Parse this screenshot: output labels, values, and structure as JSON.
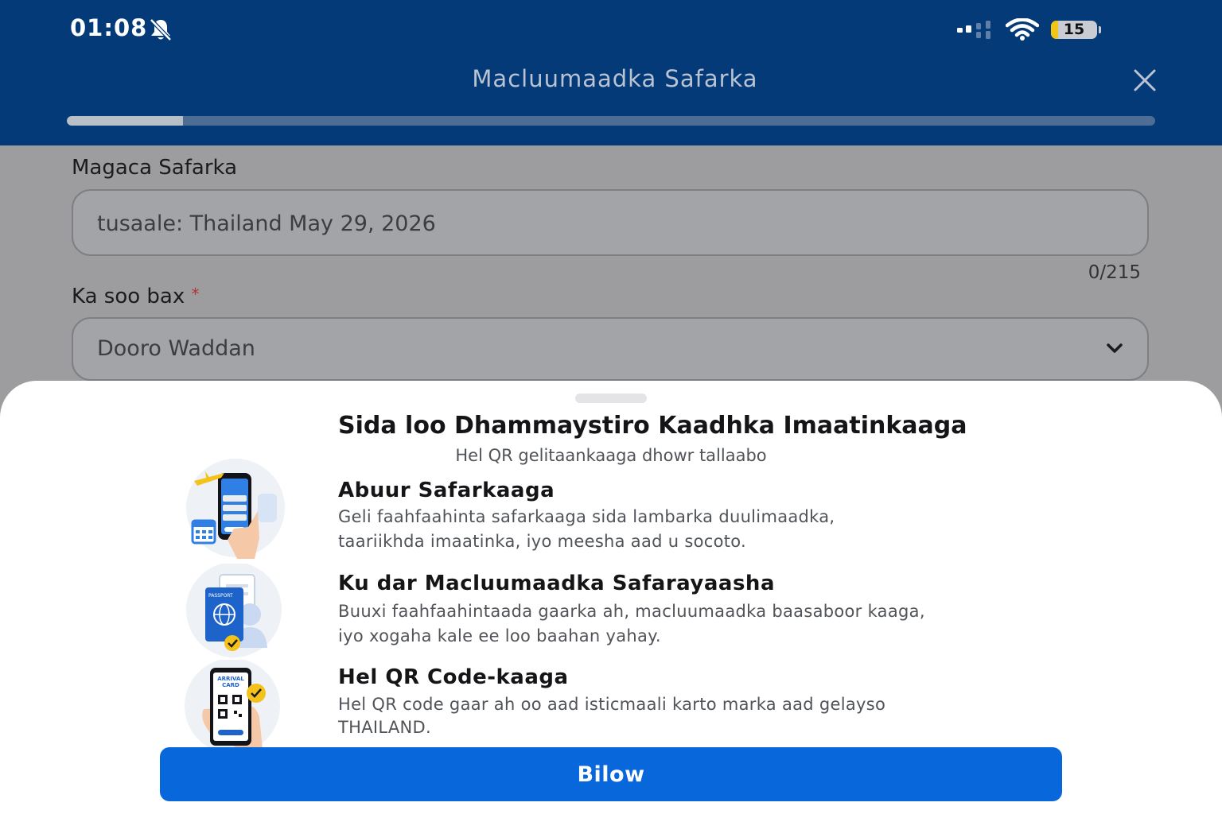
{
  "status_bar": {
    "time": "01:08",
    "battery_level": "15",
    "icons": [
      "bell-slash-icon",
      "signal-icon",
      "wifi-icon",
      "battery-icon"
    ]
  },
  "header": {
    "title": "Macluumaadka Safarka",
    "close_icon": "close-icon",
    "progress_fraction": 0.107
  },
  "form": {
    "trip_name_label": "Magaca Safarka",
    "trip_name_placeholder": "tusaale: Thailand May 29, 2026",
    "trip_name_value": "",
    "char_counter": "0/215",
    "entry_label": "Ka soo bax",
    "required_marker": "*",
    "entry_value": "Dooro Waddan"
  },
  "sheet": {
    "title": "Sida loo Dhammaystiro Kaadhka Imaatinkaaga",
    "subtitle": "Hel QR gelitaankaaga dhowr tallaabo",
    "steps": [
      {
        "title": "Abuur Safarkaaga",
        "desc_line1": "Geli faahfaahinta safarkaaga sida lambarka duulimaadka,",
        "desc_line2": "taariikhda imaatinka, iyo meesha aad u socoto.",
        "icon": "phone-checklist-plane-icon"
      },
      {
        "title": "Ku dar Macluumaadka Safarayaasha",
        "desc_line1": "Buuxi faahfaahintaada gaarka ah, macluumaadka baasaboor kaaga,",
        "desc_line2": "iyo xogaha kale ee loo baahan yahay.",
        "icon": "passport-person-icon",
        "icon_text": "PASSPORT"
      },
      {
        "title": "Hel QR Code-kaaga",
        "desc_line1": "Hel QR code gaar ah oo aad isticmaali karto marka aad gelayso",
        "desc_line2": "THAILAND.",
        "icon": "arrival-card-qr-icon",
        "icon_text_1": "ARRIVAL",
        "icon_text_2": "CARD"
      }
    ],
    "primary_button": "Bilow"
  },
  "colors": {
    "header_bg": "#053a79",
    "accent_blue": "#0767db",
    "battery_yellow": "#f2c518"
  }
}
